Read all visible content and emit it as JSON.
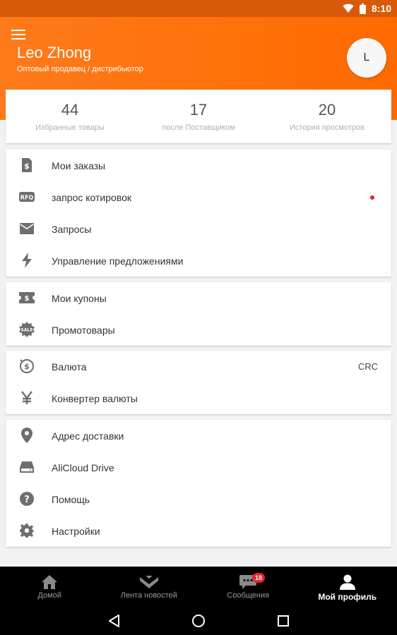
{
  "status_bar": {
    "time": "8:10"
  },
  "header": {
    "user_name": "Leo Zhong",
    "user_role": "Оптовый продавец / дистрибьютор",
    "avatar_initial": "L"
  },
  "stats": [
    {
      "value": "44",
      "label": "Избранные товары"
    },
    {
      "value": "17",
      "label": "после Поставщиком"
    },
    {
      "value": "20",
      "label": "История просмотров"
    }
  ],
  "menu_group_1": [
    {
      "label": "Мои заказы",
      "icon": "orders-icon"
    },
    {
      "label": "запрос котировок",
      "icon": "rfq-icon",
      "has_notification_dot": true
    },
    {
      "label": "Запросы",
      "icon": "mail-icon"
    },
    {
      "label": "Управление предложениями",
      "icon": "lightning-icon"
    }
  ],
  "menu_group_2": [
    {
      "label": "Мои купоны",
      "icon": "coupon-icon"
    },
    {
      "label": "Промотовары",
      "icon": "sale-icon"
    }
  ],
  "menu_group_3": [
    {
      "label": "Валюта",
      "icon": "currency-icon",
      "value": "CRC"
    },
    {
      "label": "Конвертер валюты",
      "icon": "yen-icon"
    }
  ],
  "menu_group_4": [
    {
      "label": "Адрес доставки",
      "icon": "location-icon"
    },
    {
      "label": "AliCloud Drive",
      "icon": "drive-icon"
    },
    {
      "label": "Помощь",
      "icon": "help-icon"
    },
    {
      "label": "Настройки",
      "icon": "settings-icon"
    }
  ],
  "bottom_nav": {
    "items": [
      {
        "label": "Домой",
        "icon": "home-icon"
      },
      {
        "label": "Лента новостей",
        "icon": "feed-icon"
      },
      {
        "label": "Сообщения",
        "icon": "messages-icon"
      },
      {
        "label": "Мой профиль",
        "icon": "profile-icon",
        "active": true
      }
    ],
    "messages_badge": "18"
  },
  "colors": {
    "accent": "#ff6a00",
    "status_bar": "#d65a0a",
    "icon_gray": "#6e6e6e",
    "notification": "#e8222a"
  }
}
